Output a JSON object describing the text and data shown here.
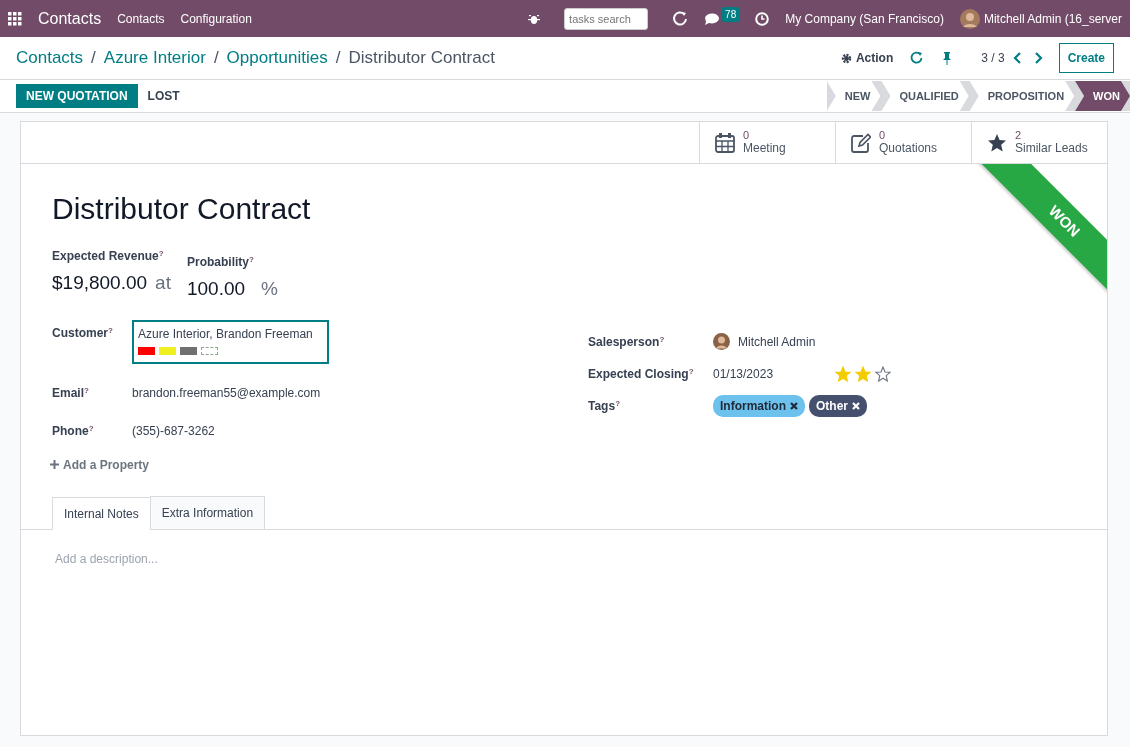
{
  "navbar": {
    "app_name": "Contacts",
    "menus": [
      "Contacts",
      "Configuration"
    ],
    "search": {
      "placeholder": "tasks search"
    },
    "messages_count": "78",
    "company": "My Company (San Francisco)",
    "user": "Mitchell Admin (16_server"
  },
  "breadcrumbs": [
    {
      "label": "Contacts",
      "separator": "/"
    },
    {
      "label": "Azure Interior",
      "separator": "/"
    },
    {
      "label": "Opportunities",
      "separator": "/"
    }
  ],
  "record_name": "Distributor Contract",
  "control": {
    "action": "Action",
    "pager": "3 / 3",
    "create": "Create"
  },
  "status_buttons": [
    {
      "label": "NEW QUOTATION",
      "kind": "primary"
    },
    {
      "label": "LOST",
      "kind": "link"
    }
  ],
  "stages": [
    {
      "label": "NEW",
      "selected": false
    },
    {
      "label": "QUALIFIED",
      "selected": false
    },
    {
      "label": "PROPOSITION",
      "selected": false
    },
    {
      "label": "WON",
      "selected": true
    }
  ],
  "smart_buttons": [
    {
      "kind": "calendar",
      "count": "0",
      "label": "Meeting"
    },
    {
      "kind": "edit",
      "count": "0",
      "label": "Quotations"
    },
    {
      "kind": "star",
      "count": "2",
      "label": "Similar Leads"
    }
  ],
  "ribbon": "WON",
  "title": "Distributor Contract",
  "revenue": {
    "label": "Expected Revenue$^{?}$",
    "amount": "$19,800.00",
    "at": "at",
    "probability_label": "Probability$^{?}$",
    "probability": "100.00",
    "percent": "%"
  },
  "left_fields": [
    {
      "label": "Customer$^{?}$",
      "value": "Azure Interior, Brandon Freeman",
      "kind": "customer",
      "swatches": [
        {
          "kind": "filled",
          "color": "#ff0000"
        },
        {
          "kind": "filled",
          "color": "#f0f020"
        },
        {
          "kind": "filled",
          "color": "#707070"
        },
        {
          "kind": "empty"
        }
      ]
    },
    {
      "label": "Email$^{?}$",
      "value": "brandon.freeman55@example.com",
      "kind": "text"
    },
    {
      "label": "Phone$^{?}$",
      "value": "(355)-687-3262",
      "kind": "text"
    }
  ],
  "add_property": "Add a Property",
  "right_fields": [
    {
      "label": "Salesperson$^{?}$",
      "value": "Mitchell Admin",
      "kind": "user"
    },
    {
      "label": "Expected Closing$^{?}$",
      "value": "01/13/2023",
      "kind": "date",
      "stars": 2
    },
    {
      "label": "Tags$^{?}$",
      "kind": "tags",
      "tags": [
        {
          "label": "Information",
          "color": "#6cc1ed"
        },
        {
          "label": "Other",
          "color": "#454f6e"
        }
      ]
    }
  ],
  "tabs": [
    {
      "label": "Internal Notes",
      "selected": true
    },
    {
      "label": "Extra Information",
      "selected": false
    }
  ],
  "description": {
    "placeholder": "Add a description..."
  }
}
